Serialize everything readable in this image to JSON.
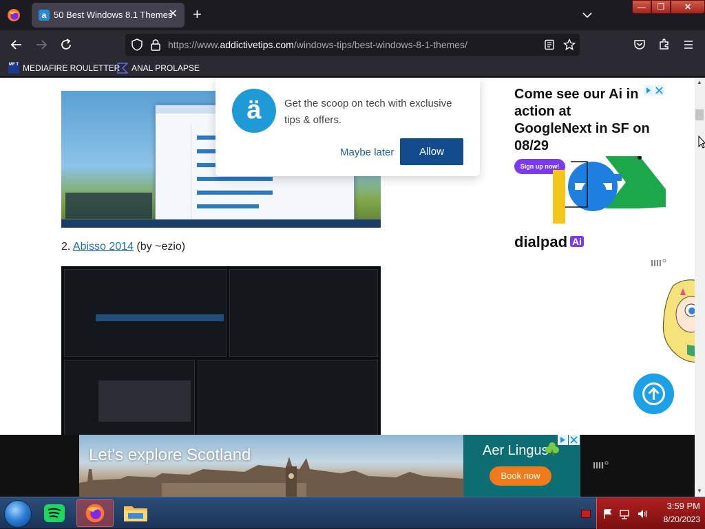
{
  "browser": {
    "tab": {
      "title": "50 Best Windows 8.1 Themes",
      "favicon": "a",
      "close": "✕"
    },
    "new_tab": "+",
    "url": {
      "prefix": "https://www.",
      "host": "addictivetips.com",
      "path": "/windows-tips/best-windows-8-1-themes/"
    },
    "bookmarks": [
      {
        "label": "MEDIAFIRE ROULETTER",
        "icon": "MF T"
      },
      {
        "label": "ANAL PROLAPSE"
      }
    ],
    "window_controls": {
      "minimize": "—",
      "maximize": "❐",
      "close": "✕"
    }
  },
  "page": {
    "item2": {
      "number": "2.",
      "link": "Abisso 2014",
      "credit": "(by ~ezio)"
    }
  },
  "notification": {
    "logo": "ä",
    "message": "Get the scoop on tech with exclusive tips & offers.",
    "dismiss": "Maybe later",
    "allow": "Allow"
  },
  "ad_right": {
    "headline": "Come see our Ai in action at GoogleNext in SF on 08/29",
    "cta": "Sign up now!",
    "brand": "dialpad",
    "brand_badge": "Ai",
    "accent_color": "#7c3aed"
  },
  "ad_bottom": {
    "headline": "Let's explore Scotland",
    "airline": "Aer Lingus",
    "cta": "Book now",
    "brand_color": "#0c6e73",
    "cta_color": "#f27a1a"
  },
  "taskbar": {
    "apps": [
      "spotify-icon",
      "firefox-icon",
      "file-explorer-icon"
    ],
    "clock_time": "3:59 PM",
    "clock_date": "8/20/2023"
  }
}
